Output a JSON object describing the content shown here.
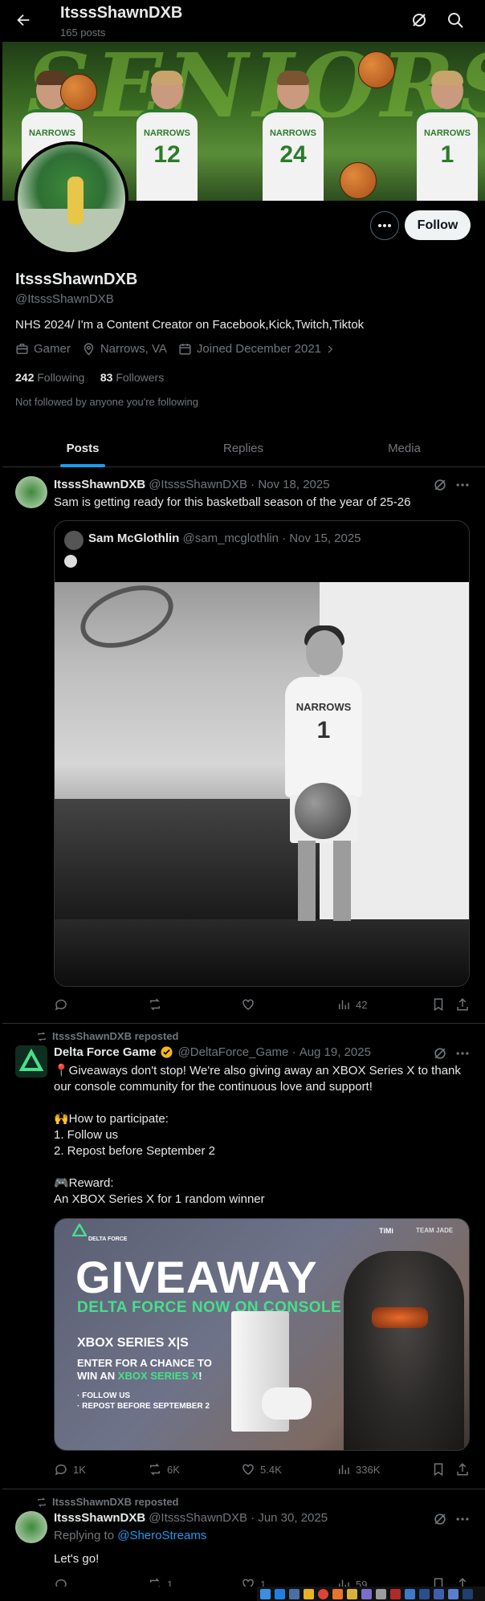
{
  "header": {
    "title": "ItsssShawnDXB",
    "post_count": "165 posts"
  },
  "profile": {
    "banner_text": "SENIORS",
    "players": [
      {
        "team": "NARROWS",
        "number": "1"
      },
      {
        "team": "NARROWS",
        "number": "12"
      },
      {
        "team": "NARROWS",
        "number": "24"
      },
      {
        "team": "NARROWS",
        "number": "1"
      }
    ],
    "name": "ItsssShawnDXB",
    "handle": "@ItsssShawnDXB",
    "bio": "NHS 2024/ I'm a Content Creator on Facebook,Kick,Twitch,Tiktok",
    "category": "Gamer",
    "location": "Narrows, VA",
    "joined": "Joined December 2021",
    "following_count": "242",
    "following_label": "Following",
    "followers_count": "83",
    "followers_label": "Followers",
    "followed_note": "Not followed by anyone you're following",
    "follow_label": "Follow"
  },
  "tabs": [
    {
      "label": "Posts",
      "active": true
    },
    {
      "label": "Replies",
      "active": false
    },
    {
      "label": "Media",
      "active": false
    }
  ],
  "posts": [
    {
      "author": "ItsssShawnDXB",
      "handle": "@ItsssShawnDXB",
      "date": "Nov 18, 2025",
      "text": "Sam is getting ready for this basketball season of the year of 25-26",
      "quote": {
        "author": "Sam McGlothlin",
        "handle": "@sam_mcglothlin",
        "date": "Nov 15, 2025",
        "image_jersey_team": "NARROWS",
        "image_jersey_number": "1"
      },
      "stats": {
        "replies": "",
        "reposts": "",
        "likes": "",
        "views": "42"
      }
    },
    {
      "repost_label": "ItsssShawnDXB reposted",
      "author": "Delta Force Game",
      "handle": "@DeltaForce_Game",
      "date": "Aug 19, 2025",
      "text_lines": [
        "📍Giveaways don't stop! We're also giving away an XBOX Series X to thank our console community for the continuous love and support!",
        "",
        "🙌How to participate:",
        "1. Follow us",
        "2. Repost before September 2",
        "",
        "🎮Reward:",
        "An XBOX Series X for 1 random winner"
      ],
      "image": {
        "brand": "DELTA FORCE",
        "partner1": "TiMi",
        "partner2": "TEAM JADE",
        "title": "GIVEAWAY",
        "subtitle": "DELTA FORCE NOW ON CONSOLE",
        "console": "XBOX SERIES X|S",
        "enter_line1": "ENTER FOR A CHANCE TO",
        "enter_line2_a": "WIN AN ",
        "enter_line2_b": "XBOX SERIES X",
        "enter_line2_c": "!",
        "list1": "· FOLLOW US",
        "list2": "· REPOST BEFORE SEPTEMBER 2"
      },
      "stats": {
        "replies": "1K",
        "reposts": "6K",
        "likes": "5.4K",
        "views": "336K"
      }
    },
    {
      "repost_label": "ItsssShawnDXB reposted",
      "author": "ItsssShawnDXB",
      "handle": "@ItsssShawnDXB",
      "date": "Jun 30, 2025",
      "replying_to_label": "Replying to",
      "replying_to": "@SheroStreams",
      "text": "Let's go!",
      "stats": {
        "replies": "",
        "reposts": "1",
        "likes": "1",
        "views": "59"
      }
    }
  ],
  "colors": {
    "accent": "#1d9bf0",
    "muted": "#71767b",
    "border": "#2f3336",
    "verified": "#f4b71a",
    "delta_green": "#46e08b"
  }
}
